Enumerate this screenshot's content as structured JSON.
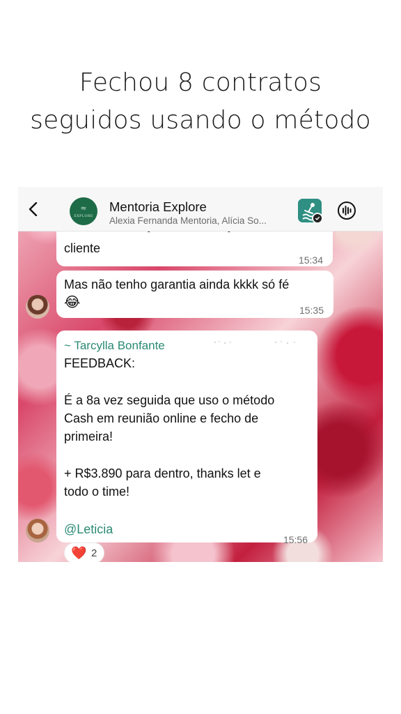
{
  "headline": {
    "line1": "Fechou 8 contratos",
    "line2": "seguidos usando o método"
  },
  "chat_header": {
    "title": "Mentoria Explore",
    "subtitle": "Alexia Fernanda Mentoria, Alícia So...",
    "avatar_wave": "≈",
    "avatar_brand": "EXPLORE"
  },
  "messages": [
    {
      "partial_line": "muitas construções de indicação desse",
      "text": "cliente",
      "time": "15:34"
    },
    {
      "text": "Mas não tenho garantia ainda kkkk só fé",
      "emoji": "😂",
      "time": "15:35"
    },
    {
      "sender": "~ Tarcylla Bonfante",
      "body_lines": [
        "FEEDBACK:",
        "",
        "É a 8a vez seguida que uso o método",
        "Cash em reunião online e fecho de",
        "primeira!",
        "",
        "+ R$3.890 para dentro, thanks let e",
        "todo o time!"
      ],
      "mention": "@Leticia",
      "time": "15:56",
      "reaction": {
        "emoji": "❤️",
        "count": "2"
      }
    }
  ],
  "colors": {
    "sender_green": "#2a8a73",
    "group_avatar": "#1e6b47",
    "badge_teal": "#2e8f82"
  },
  "icons": [
    "chevron-left-icon",
    "group-avatar",
    "app-badge-icon",
    "audio-call-icon",
    "heart-icon"
  ]
}
